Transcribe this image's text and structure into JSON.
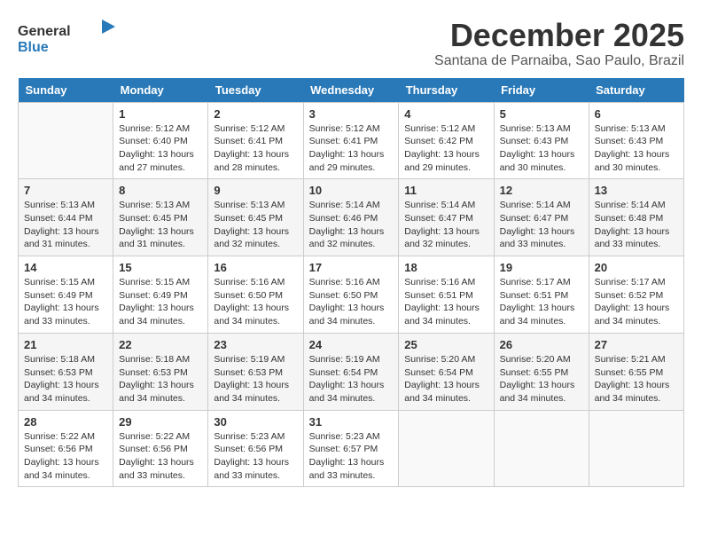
{
  "header": {
    "logo_general": "General",
    "logo_blue": "Blue",
    "title": "December 2025",
    "subtitle": "Santana de Parnaiba, Sao Paulo, Brazil"
  },
  "calendar": {
    "days_of_week": [
      "Sunday",
      "Monday",
      "Tuesday",
      "Wednesday",
      "Thursday",
      "Friday",
      "Saturday"
    ],
    "weeks": [
      [
        {
          "day": "",
          "sunrise": "",
          "sunset": "",
          "daylight": ""
        },
        {
          "day": "1",
          "sunrise": "Sunrise: 5:12 AM",
          "sunset": "Sunset: 6:40 PM",
          "daylight": "Daylight: 13 hours and 27 minutes."
        },
        {
          "day": "2",
          "sunrise": "Sunrise: 5:12 AM",
          "sunset": "Sunset: 6:41 PM",
          "daylight": "Daylight: 13 hours and 28 minutes."
        },
        {
          "day": "3",
          "sunrise": "Sunrise: 5:12 AM",
          "sunset": "Sunset: 6:41 PM",
          "daylight": "Daylight: 13 hours and 29 minutes."
        },
        {
          "day": "4",
          "sunrise": "Sunrise: 5:12 AM",
          "sunset": "Sunset: 6:42 PM",
          "daylight": "Daylight: 13 hours and 29 minutes."
        },
        {
          "day": "5",
          "sunrise": "Sunrise: 5:13 AM",
          "sunset": "Sunset: 6:43 PM",
          "daylight": "Daylight: 13 hours and 30 minutes."
        },
        {
          "day": "6",
          "sunrise": "Sunrise: 5:13 AM",
          "sunset": "Sunset: 6:43 PM",
          "daylight": "Daylight: 13 hours and 30 minutes."
        }
      ],
      [
        {
          "day": "7",
          "sunrise": "Sunrise: 5:13 AM",
          "sunset": "Sunset: 6:44 PM",
          "daylight": "Daylight: 13 hours and 31 minutes."
        },
        {
          "day": "8",
          "sunrise": "Sunrise: 5:13 AM",
          "sunset": "Sunset: 6:45 PM",
          "daylight": "Daylight: 13 hours and 31 minutes."
        },
        {
          "day": "9",
          "sunrise": "Sunrise: 5:13 AM",
          "sunset": "Sunset: 6:45 PM",
          "daylight": "Daylight: 13 hours and 32 minutes."
        },
        {
          "day": "10",
          "sunrise": "Sunrise: 5:14 AM",
          "sunset": "Sunset: 6:46 PM",
          "daylight": "Daylight: 13 hours and 32 minutes."
        },
        {
          "day": "11",
          "sunrise": "Sunrise: 5:14 AM",
          "sunset": "Sunset: 6:47 PM",
          "daylight": "Daylight: 13 hours and 32 minutes."
        },
        {
          "day": "12",
          "sunrise": "Sunrise: 5:14 AM",
          "sunset": "Sunset: 6:47 PM",
          "daylight": "Daylight: 13 hours and 33 minutes."
        },
        {
          "day": "13",
          "sunrise": "Sunrise: 5:14 AM",
          "sunset": "Sunset: 6:48 PM",
          "daylight": "Daylight: 13 hours and 33 minutes."
        }
      ],
      [
        {
          "day": "14",
          "sunrise": "Sunrise: 5:15 AM",
          "sunset": "Sunset: 6:49 PM",
          "daylight": "Daylight: 13 hours and 33 minutes."
        },
        {
          "day": "15",
          "sunrise": "Sunrise: 5:15 AM",
          "sunset": "Sunset: 6:49 PM",
          "daylight": "Daylight: 13 hours and 34 minutes."
        },
        {
          "day": "16",
          "sunrise": "Sunrise: 5:16 AM",
          "sunset": "Sunset: 6:50 PM",
          "daylight": "Daylight: 13 hours and 34 minutes."
        },
        {
          "day": "17",
          "sunrise": "Sunrise: 5:16 AM",
          "sunset": "Sunset: 6:50 PM",
          "daylight": "Daylight: 13 hours and 34 minutes."
        },
        {
          "day": "18",
          "sunrise": "Sunrise: 5:16 AM",
          "sunset": "Sunset: 6:51 PM",
          "daylight": "Daylight: 13 hours and 34 minutes."
        },
        {
          "day": "19",
          "sunrise": "Sunrise: 5:17 AM",
          "sunset": "Sunset: 6:51 PM",
          "daylight": "Daylight: 13 hours and 34 minutes."
        },
        {
          "day": "20",
          "sunrise": "Sunrise: 5:17 AM",
          "sunset": "Sunset: 6:52 PM",
          "daylight": "Daylight: 13 hours and 34 minutes."
        }
      ],
      [
        {
          "day": "21",
          "sunrise": "Sunrise: 5:18 AM",
          "sunset": "Sunset: 6:53 PM",
          "daylight": "Daylight: 13 hours and 34 minutes."
        },
        {
          "day": "22",
          "sunrise": "Sunrise: 5:18 AM",
          "sunset": "Sunset: 6:53 PM",
          "daylight": "Daylight: 13 hours and 34 minutes."
        },
        {
          "day": "23",
          "sunrise": "Sunrise: 5:19 AM",
          "sunset": "Sunset: 6:53 PM",
          "daylight": "Daylight: 13 hours and 34 minutes."
        },
        {
          "day": "24",
          "sunrise": "Sunrise: 5:19 AM",
          "sunset": "Sunset: 6:54 PM",
          "daylight": "Daylight: 13 hours and 34 minutes."
        },
        {
          "day": "25",
          "sunrise": "Sunrise: 5:20 AM",
          "sunset": "Sunset: 6:54 PM",
          "daylight": "Daylight: 13 hours and 34 minutes."
        },
        {
          "day": "26",
          "sunrise": "Sunrise: 5:20 AM",
          "sunset": "Sunset: 6:55 PM",
          "daylight": "Daylight: 13 hours and 34 minutes."
        },
        {
          "day": "27",
          "sunrise": "Sunrise: 5:21 AM",
          "sunset": "Sunset: 6:55 PM",
          "daylight": "Daylight: 13 hours and 34 minutes."
        }
      ],
      [
        {
          "day": "28",
          "sunrise": "Sunrise: 5:22 AM",
          "sunset": "Sunset: 6:56 PM",
          "daylight": "Daylight: 13 hours and 34 minutes."
        },
        {
          "day": "29",
          "sunrise": "Sunrise: 5:22 AM",
          "sunset": "Sunset: 6:56 PM",
          "daylight": "Daylight: 13 hours and 33 minutes."
        },
        {
          "day": "30",
          "sunrise": "Sunrise: 5:23 AM",
          "sunset": "Sunset: 6:56 PM",
          "daylight": "Daylight: 13 hours and 33 minutes."
        },
        {
          "day": "31",
          "sunrise": "Sunrise: 5:23 AM",
          "sunset": "Sunset: 6:57 PM",
          "daylight": "Daylight: 13 hours and 33 minutes."
        },
        {
          "day": "",
          "sunrise": "",
          "sunset": "",
          "daylight": ""
        },
        {
          "day": "",
          "sunrise": "",
          "sunset": "",
          "daylight": ""
        },
        {
          "day": "",
          "sunrise": "",
          "sunset": "",
          "daylight": ""
        }
      ]
    ]
  }
}
